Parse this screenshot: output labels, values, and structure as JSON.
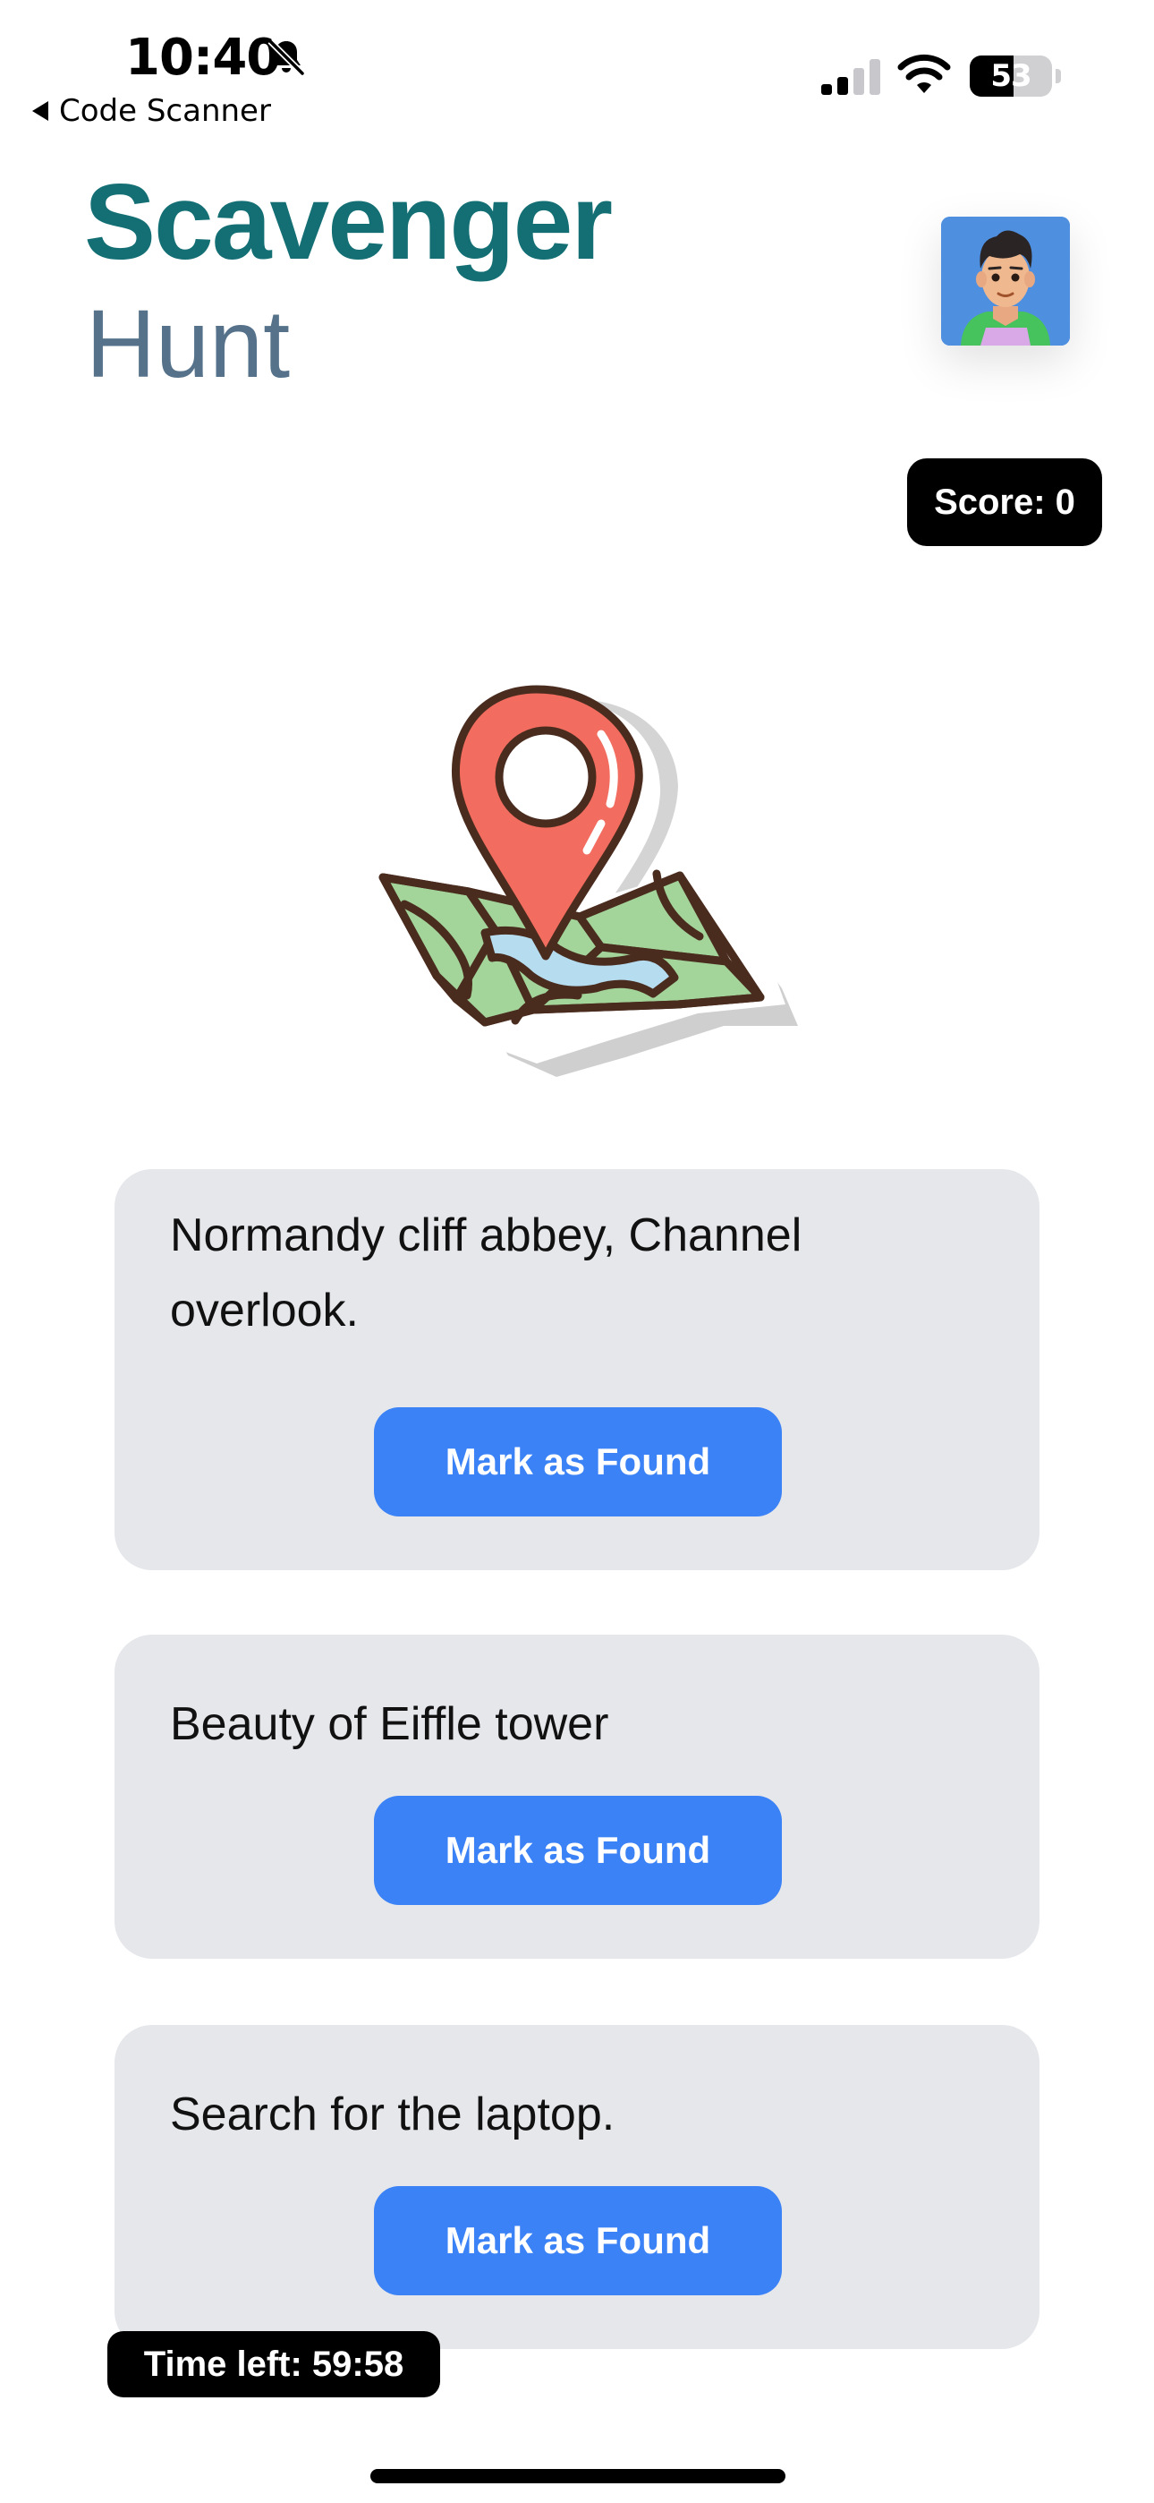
{
  "status_bar": {
    "time": "10:40",
    "back_label": "Code Scanner",
    "battery_level": "53",
    "battery_fraction": 0.53
  },
  "header": {
    "title": "Scavenger",
    "subtitle": "Hunt",
    "score_label": "Score: 0"
  },
  "clues": [
    {
      "text": "Normandy cliff abbey, Channel overlook.",
      "button_label": "Mark as Found"
    },
    {
      "text": "Beauty of Eiffle tower",
      "button_label": "Mark as Found"
    },
    {
      "text": "Search for the laptop.",
      "button_label": "Mark as Found"
    }
  ],
  "timer_label": "Time left: 59:58",
  "icons": {
    "bell": "bell-slash-icon",
    "signal": "cellular-signal-icon",
    "wifi": "wifi-icon",
    "back": "back-arrow-icon",
    "avatar": "user-avatar",
    "map": "map-pin-icon"
  },
  "colors": {
    "title": "#136f74",
    "subtitle": "#55728a",
    "button": "#3b82f6",
    "card": "#e5e7eb",
    "badge": "#000000",
    "pin": "#f26d5f",
    "map_green": "#a3d49a",
    "map_water": "#b5dcef"
  }
}
